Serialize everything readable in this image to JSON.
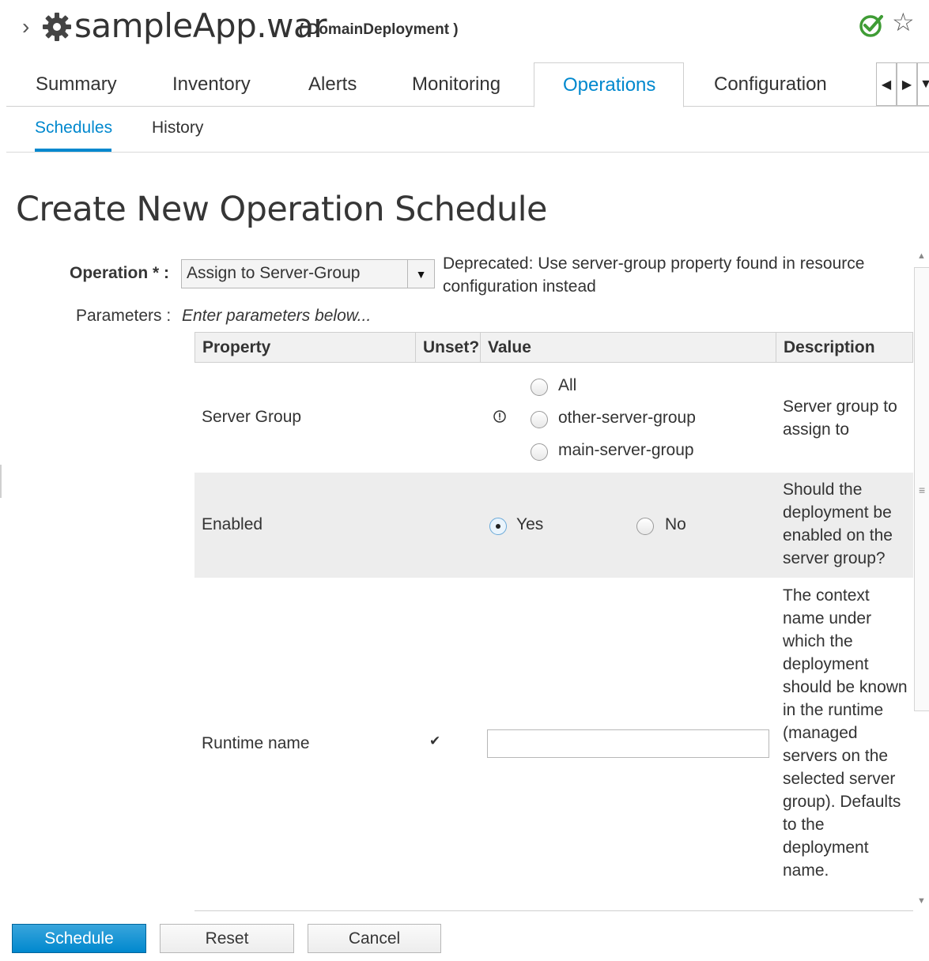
{
  "header": {
    "breadcrumb_chevron": "›",
    "title": "sampleApp.war",
    "subtitle": "( DomainDeployment )",
    "status_icon": "check-circle-icon",
    "favorite_icon": "star-outline-icon",
    "status_color": "#3f9c35"
  },
  "tabs": [
    {
      "label": "Summary"
    },
    {
      "label": "Inventory"
    },
    {
      "label": "Alerts"
    },
    {
      "label": "Monitoring"
    },
    {
      "label": "Operations",
      "active": true
    },
    {
      "label": "Configuration"
    }
  ],
  "subtabs": [
    {
      "label": "Schedules",
      "active": true
    },
    {
      "label": "History"
    }
  ],
  "page_title": "Create New Operation Schedule",
  "operation": {
    "label": "Operation * :",
    "selected": "Assign to Server-Group",
    "description": "Deprecated: Use server-group property found in resource configuration instead"
  },
  "parameters": {
    "label": "Parameters :",
    "hint": "Enter parameters below..."
  },
  "table": {
    "headers": [
      "Property",
      "Unset?",
      "Value",
      "Description"
    ],
    "rows": [
      {
        "property": "Server Group",
        "unset_icon": "required-info-icon",
        "options": [
          "All",
          "other-server-group",
          "main-server-group"
        ],
        "description": "Server group to assign to"
      },
      {
        "property": "Enabled",
        "options": [
          "Yes",
          "No"
        ],
        "selected": "Yes",
        "description": "Should the deployment be enabled on the server group?"
      },
      {
        "property": "Runtime name",
        "unset_icon": "checkmark-icon",
        "value": "",
        "description": "The context name under which the deployment should be known in the runtime (managed servers on the selected server group). Defaults to the deployment name."
      }
    ]
  },
  "buttons": {
    "schedule": "Schedule",
    "reset": "Reset",
    "cancel": "Cancel"
  },
  "colors": {
    "accent": "#0088ce",
    "row_highlight": "#ededed"
  }
}
